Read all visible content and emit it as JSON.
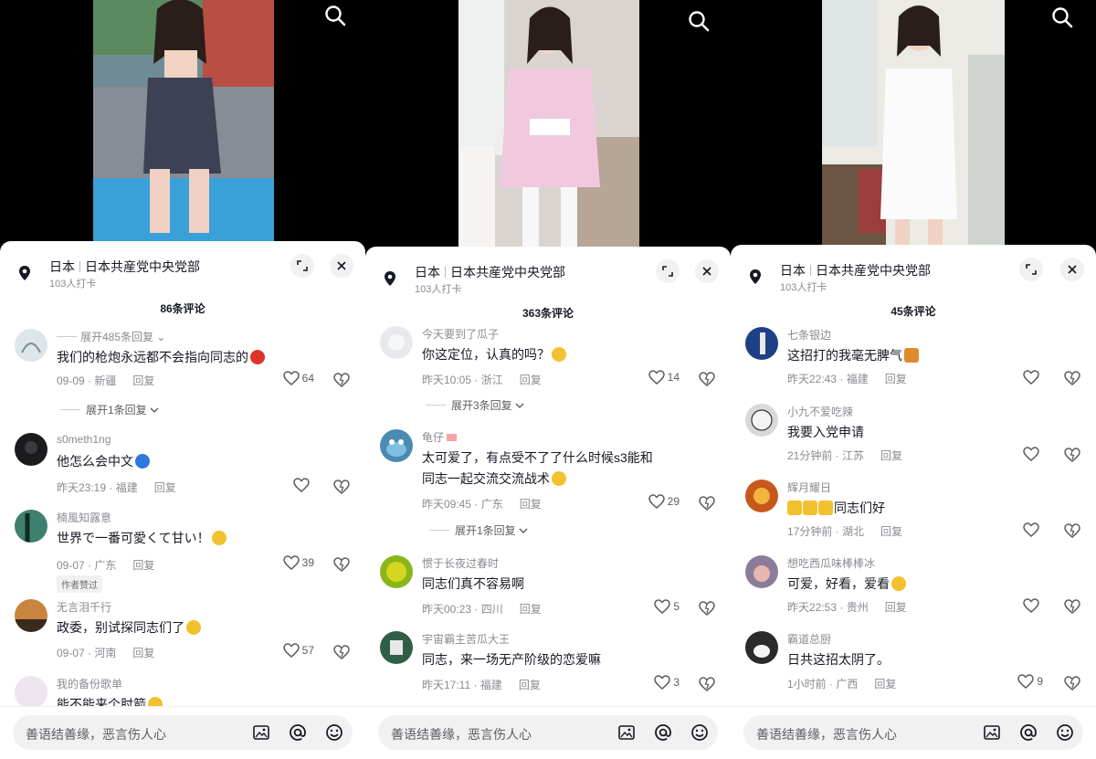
{
  "panels": [
    {
      "location": {
        "country": "日本",
        "place": "日本共産党中央党部",
        "checkins": "103人打卡"
      },
      "comment_count": "86条评论",
      "comments": [
        {
          "user": "展开485条回复",
          "text": "我们的枪炮永远都不会指向同志的",
          "date": "09-09 · 新疆",
          "likes": "64",
          "avatar_color": "#dfe6ea"
        },
        {
          "user": "s0meth1ng",
          "text": "他怎么会中文",
          "date": "昨天23:19 · 福建",
          "likes": "",
          "avatar_color": "#1b1b1d"
        },
        {
          "user": "楠風知露意",
          "text": "世界で一番可愛くて甘い！",
          "date": "09-07 · 广东",
          "likes": "39",
          "avatar_color": "#3f7f6f",
          "badge": "作者赞过"
        },
        {
          "user": "无言泪千行",
          "text": "政委，别试探同志们了",
          "date": "09-07 · 河南",
          "likes": "57",
          "avatar_color": "#c9853f"
        },
        {
          "user": "我的备份歌单",
          "text": "能不能来个肘箭",
          "date": "",
          "likes": "",
          "avatar_color": "#eee4ef"
        }
      ],
      "expand_label": "展开1条回复",
      "reply_label": "回复"
    },
    {
      "location": {
        "country": "日本",
        "place": "日本共産党中央党部",
        "checkins": "103人打卡"
      },
      "comment_count": "363条评论",
      "comments": [
        {
          "user": "今天要到了瓜子",
          "text": "你这定位，认真的吗？",
          "date": "昨天10:05 · 浙江",
          "likes": "14",
          "avatar_color": "#e7e9ec"
        },
        {
          "user": "龟仔",
          "text": "太可爱了，有点受不了了什么时候s3能和同志一起交流交流战术",
          "date": "昨天09:45 · 广东",
          "likes": "29",
          "avatar_color": "#4a8bb2"
        },
        {
          "user": "惯于长夜过春时",
          "text": "同志们真不容易啊",
          "date": "昨天00:23 · 四川",
          "likes": "5",
          "avatar_color": "#8bb61a"
        },
        {
          "user": "宇宙霸主苦瓜大王",
          "text": "同志，来一场无产阶级的恋爱嘛",
          "date": "昨天17:11 · 福建",
          "likes": "3",
          "avatar_color": "#2f5f44"
        }
      ],
      "expand_labels": [
        "展开3条回复",
        "展开1条回复"
      ],
      "reply_label": "回复"
    },
    {
      "location": {
        "country": "日本",
        "place": "日本共産党中央党部",
        "checkins": "103人打卡"
      },
      "comment_count": "45条评论",
      "comments": [
        {
          "user": "七条银边",
          "text": "这招打的我毫无脾气",
          "date": "昨天22:43 · 福建",
          "likes": "",
          "avatar_color": "#1f3f86"
        },
        {
          "user": "小九不爱吃辣",
          "text": "我要入党申请",
          "date": "21分钟前 · 江苏",
          "likes": "",
          "avatar_color": "#d9d9d9"
        },
        {
          "user": "辉月耀日",
          "text": "同志们好",
          "date": "17分钟前 · 湖北",
          "likes": "",
          "avatar_color": "#c7581d"
        },
        {
          "user": "想吃西瓜味棒棒冰",
          "text": "可爱，好看，爱看",
          "date": "昨天22:53 · 贵州",
          "likes": "",
          "avatar_color": "#8b7d9a"
        },
        {
          "user": "霸道总厨",
          "text": "日共这招太阴了。",
          "date": "1小时前 · 广西",
          "likes": "9",
          "avatar_color": "#2b2b2b"
        }
      ],
      "reply_label": "回复"
    }
  ],
  "input": {
    "placeholder": "善语结善缘，恶言伤人心"
  },
  "icons": [
    "search-icon",
    "location-pin-icon",
    "expand-icon",
    "close-icon",
    "heart-icon",
    "dislike-icon",
    "image-icon",
    "mention-icon",
    "emoji-icon",
    "chevron-down-icon"
  ],
  "colors": {
    "sheet": "#ffffff",
    "text": "#161823",
    "secondary": "#8a8b91",
    "pill": "#f1f1f2"
  }
}
